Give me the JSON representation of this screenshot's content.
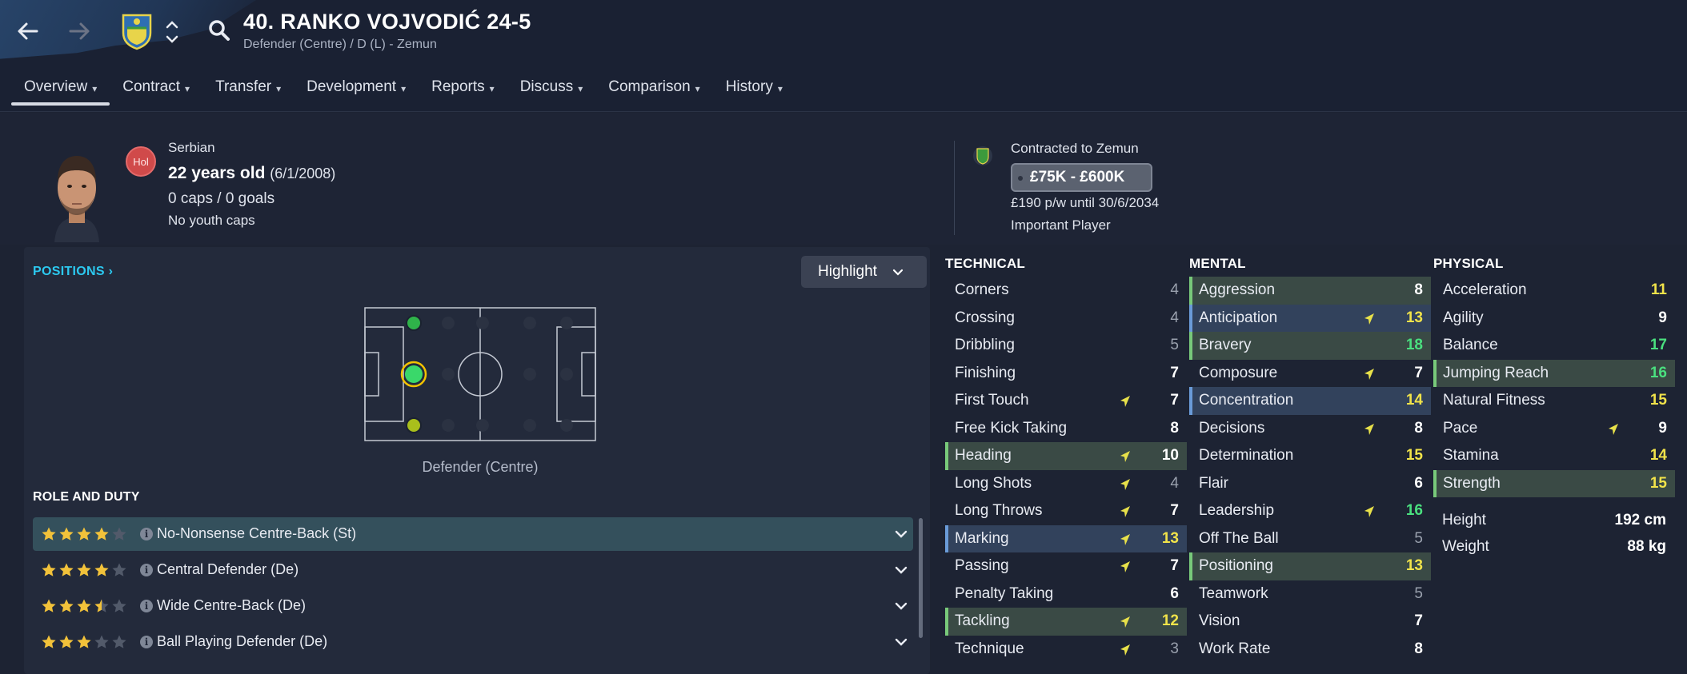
{
  "header": {
    "title": "40. RANKO VOJVODIĆ 24-5",
    "subtitle": "Defender (Centre) / D (L) - Zemun"
  },
  "tabs": [
    {
      "label": "Overview",
      "active": true
    },
    {
      "label": "Contract"
    },
    {
      "label": "Transfer"
    },
    {
      "label": "Development"
    },
    {
      "label": "Reports"
    },
    {
      "label": "Discuss"
    },
    {
      "label": "Comparison"
    },
    {
      "label": "History"
    }
  ],
  "profile": {
    "badge": "Hol",
    "nationality": "Serbian",
    "age": "22 years old",
    "dob": "(6/1/2008)",
    "caps": "0 caps / 0 goals",
    "youth_caps": "No youth caps"
  },
  "contract": {
    "club_line": "Contracted to Zemun",
    "value_range": "£75K - £600K",
    "wage": "£190 p/w until 30/6/2034",
    "status": "Important Player"
  },
  "positions": {
    "link": "POSITIONS",
    "highlight_label": "Highlight",
    "position_label": "Defender (Centre)"
  },
  "roles": {
    "heading": "ROLE AND DUTY",
    "items": [
      {
        "name": "No-Nonsense Centre-Back (St)",
        "stars": 4,
        "selected": true
      },
      {
        "name": "Central Defender (De)",
        "stars": 4
      },
      {
        "name": "Wide Centre-Back (De)",
        "stars": 3.5
      },
      {
        "name": "Ball Playing Defender (De)",
        "stars": 3
      }
    ]
  },
  "attributes": {
    "technical": {
      "heading": "TECHNICAL",
      "items": [
        {
          "name": "Corners",
          "value": "4",
          "tone": "grey"
        },
        {
          "name": "Crossing",
          "value": "4",
          "tone": "grey"
        },
        {
          "name": "Dribbling",
          "value": "5",
          "tone": "grey"
        },
        {
          "name": "Finishing",
          "value": "7",
          "tone": "white"
        },
        {
          "name": "First Touch",
          "value": "7",
          "tone": "white",
          "arrow": true
        },
        {
          "name": "Free Kick Taking",
          "value": "8",
          "tone": "white"
        },
        {
          "name": "Heading",
          "value": "10",
          "tone": "white",
          "arrow": true,
          "hl": "green"
        },
        {
          "name": "Long Shots",
          "value": "4",
          "tone": "grey",
          "arrow": true
        },
        {
          "name": "Long Throws",
          "value": "7",
          "tone": "white",
          "arrow": true
        },
        {
          "name": "Marking",
          "value": "13",
          "tone": "yellow",
          "arrow": true,
          "hl": "blue"
        },
        {
          "name": "Passing",
          "value": "7",
          "tone": "white",
          "arrow": true
        },
        {
          "name": "Penalty Taking",
          "value": "6",
          "tone": "white"
        },
        {
          "name": "Tackling",
          "value": "12",
          "tone": "yellow",
          "arrow": true,
          "hl": "green"
        },
        {
          "name": "Technique",
          "value": "3",
          "tone": "grey",
          "arrow": true
        }
      ]
    },
    "mental": {
      "heading": "MENTAL",
      "items": [
        {
          "name": "Aggression",
          "value": "8",
          "tone": "white",
          "hl": "green"
        },
        {
          "name": "Anticipation",
          "value": "13",
          "tone": "yellow",
          "arrow": true,
          "hl": "blue"
        },
        {
          "name": "Bravery",
          "value": "18",
          "tone": "green",
          "hl": "green"
        },
        {
          "name": "Composure",
          "value": "7",
          "tone": "white",
          "arrow": true
        },
        {
          "name": "Concentration",
          "value": "14",
          "tone": "yellow",
          "hl": "blue"
        },
        {
          "name": "Decisions",
          "value": "8",
          "tone": "white",
          "arrow": true
        },
        {
          "name": "Determination",
          "value": "15",
          "tone": "yellow"
        },
        {
          "name": "Flair",
          "value": "6",
          "tone": "white"
        },
        {
          "name": "Leadership",
          "value": "16",
          "tone": "green",
          "arrow": true
        },
        {
          "name": "Off The Ball",
          "value": "5",
          "tone": "grey"
        },
        {
          "name": "Positioning",
          "value": "13",
          "tone": "yellow",
          "hl": "green"
        },
        {
          "name": "Teamwork",
          "value": "5",
          "tone": "grey"
        },
        {
          "name": "Vision",
          "value": "7",
          "tone": "white"
        },
        {
          "name": "Work Rate",
          "value": "8",
          "tone": "white"
        }
      ]
    },
    "physical": {
      "heading": "PHYSICAL",
      "items": [
        {
          "name": "Acceleration",
          "value": "11",
          "tone": "yellow"
        },
        {
          "name": "Agility",
          "value": "9",
          "tone": "white"
        },
        {
          "name": "Balance",
          "value": "17",
          "tone": "green"
        },
        {
          "name": "Jumping Reach",
          "value": "16",
          "tone": "green",
          "hl": "green"
        },
        {
          "name": "Natural Fitness",
          "value": "15",
          "tone": "yellow"
        },
        {
          "name": "Pace",
          "value": "9",
          "tone": "white",
          "arrow": true
        },
        {
          "name": "Stamina",
          "value": "14",
          "tone": "yellow"
        },
        {
          "name": "Strength",
          "value": "15",
          "tone": "yellow",
          "hl": "green"
        }
      ],
      "height_label": "Height",
      "height_value": "192 cm",
      "weight_label": "Weight",
      "weight_value": "88 kg"
    }
  },
  "colors": {
    "accent_link": "#2cc9f0",
    "good": "#4ae07f",
    "medium": "#f1e34a",
    "key_highlight": "#78c97a",
    "pref_highlight": "#6a9bd8"
  }
}
